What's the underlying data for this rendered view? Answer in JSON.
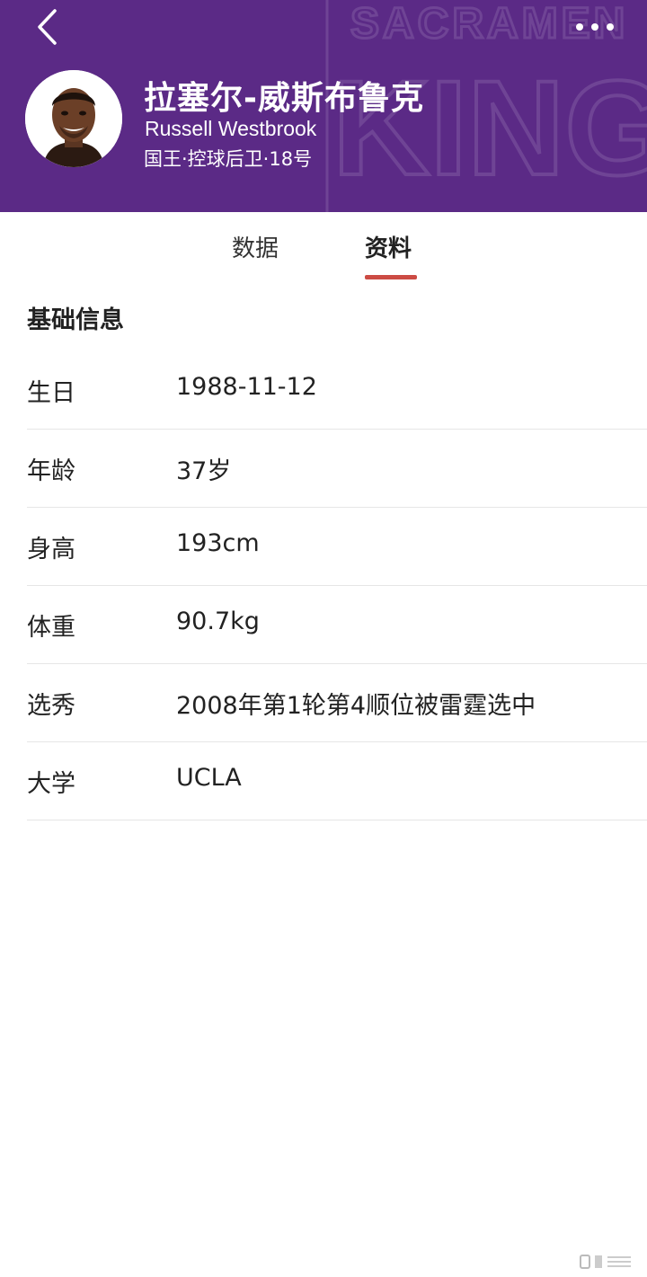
{
  "header": {
    "name_cn": "拉塞尔-威斯布鲁克",
    "name_en": "Russell Westbrook",
    "meta": "国王·控球后卫·18号",
    "background_color": "#5b2a86",
    "watermark_text": "SACRAMENTO KINGS",
    "back_icon": "chevron-left-icon",
    "more_icon": "more-dots-icon"
  },
  "tabs": [
    {
      "label": "数据",
      "active": false
    },
    {
      "label": "资料",
      "active": true
    }
  ],
  "tab_indicator_color": "#cc4b44",
  "section": {
    "title": "基础信息",
    "rows": [
      {
        "label": "生日",
        "value": "1988-11-12"
      },
      {
        "label": "年龄",
        "value": "37岁"
      },
      {
        "label": "身高",
        "value": "193cm"
      },
      {
        "label": "体重",
        "value": "90.7kg"
      },
      {
        "label": "选秀",
        "value": "2008年第1轮第4顺位被雷霆选中"
      },
      {
        "label": "大学",
        "value": "UCLA"
      }
    ]
  }
}
